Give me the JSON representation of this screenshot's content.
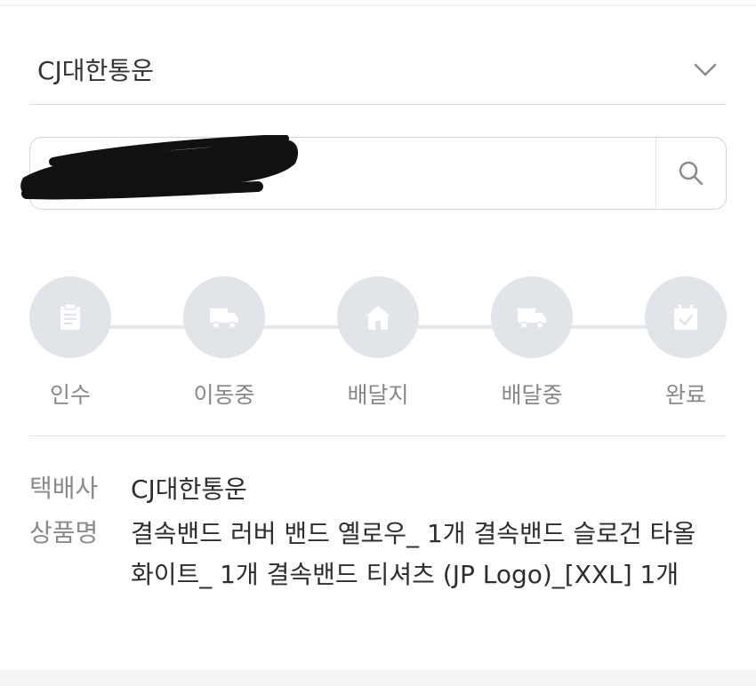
{
  "carrier": {
    "selected": "CJ대한통운",
    "chevron_icon": "chevron-down-icon"
  },
  "search": {
    "value": "",
    "placeholder": "",
    "icon": "search-icon"
  },
  "steps": [
    {
      "label": "인수",
      "icon": "document-icon"
    },
    {
      "label": "이동중",
      "icon": "truck-icon"
    },
    {
      "label": "배달지",
      "icon": "home-icon"
    },
    {
      "label": "배달중",
      "icon": "truck-icon"
    },
    {
      "label": "완료",
      "icon": "calendar-check-icon"
    }
  ],
  "info": {
    "carrier_label": "택배사",
    "carrier_value": "CJ대한통운",
    "product_label": "상품명",
    "product_value": "결속밴드 러버 밴드 옐로우_ 1개 결속밴드 슬로건 타올 화이트_ 1개 결속밴드 티셔츠 (JP Logo)_[XXL] 1개"
  },
  "colors": {
    "step_inactive": "#e1e4e8",
    "step_icon": "#ffffff",
    "label_muted": "#888888"
  }
}
